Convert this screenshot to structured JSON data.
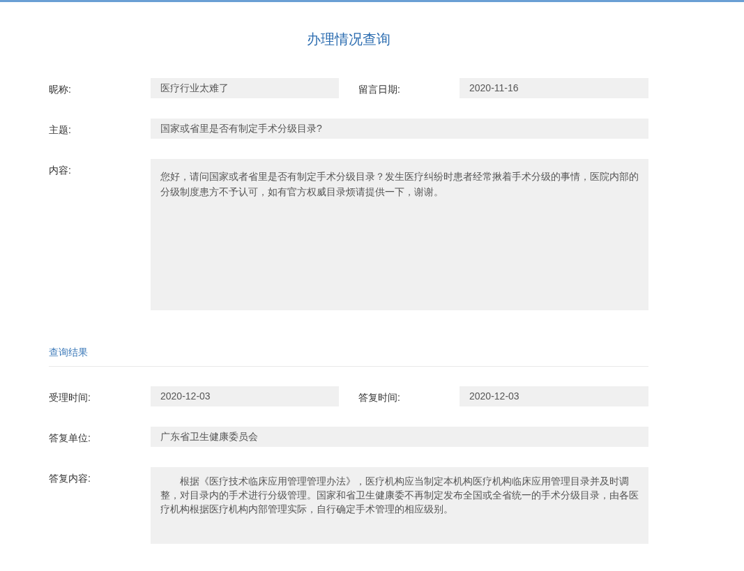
{
  "title": "办理情况查询",
  "message": {
    "rows": [
      {
        "kind": "pair",
        "fields": [
          {
            "label": "昵称:",
            "value": "医疗行业太难了"
          },
          {
            "label": "留言日期:",
            "value": "2020-11-16"
          }
        ]
      },
      {
        "kind": "single",
        "fields": [
          {
            "label": "主题:",
            "value": "国家或省里是否有制定手术分级目录?"
          }
        ]
      },
      {
        "kind": "text",
        "fields": [
          {
            "label": "内容:",
            "value": "您好，请问国家或者省里是否有制定手术分级目录？发生医疗纠纷时患者经常揪着手术分级的事情，医院内部的分级制度患方不予认可，如有官方权威目录烦请提供一下，谢谢。"
          }
        ]
      }
    ]
  },
  "result": {
    "heading": "查询结果",
    "rows": [
      {
        "kind": "pair",
        "fields": [
          {
            "label": "受理时间:",
            "value": "2020-12-03"
          },
          {
            "label": "答复时间:",
            "value": "2020-12-03"
          }
        ]
      },
      {
        "kind": "single",
        "fields": [
          {
            "label": "答复单位:",
            "value": "广东省卫生健康委员会"
          }
        ]
      },
      {
        "kind": "reply",
        "fields": [
          {
            "label": "答复内容:",
            "value": "根据《医疗技术临床应用管理管理办法》，医疗机构应当制定本机构医疗机构临床应用管理目录并及时调整，对目录内的手术进行分级管理。国家和省卫生健康委不再制定发布全国或全省统一的手术分级目录，由各医疗机构根据医疗机构内部管理实际，自行确定手术管理的相应级别。"
          }
        ]
      }
    ]
  }
}
